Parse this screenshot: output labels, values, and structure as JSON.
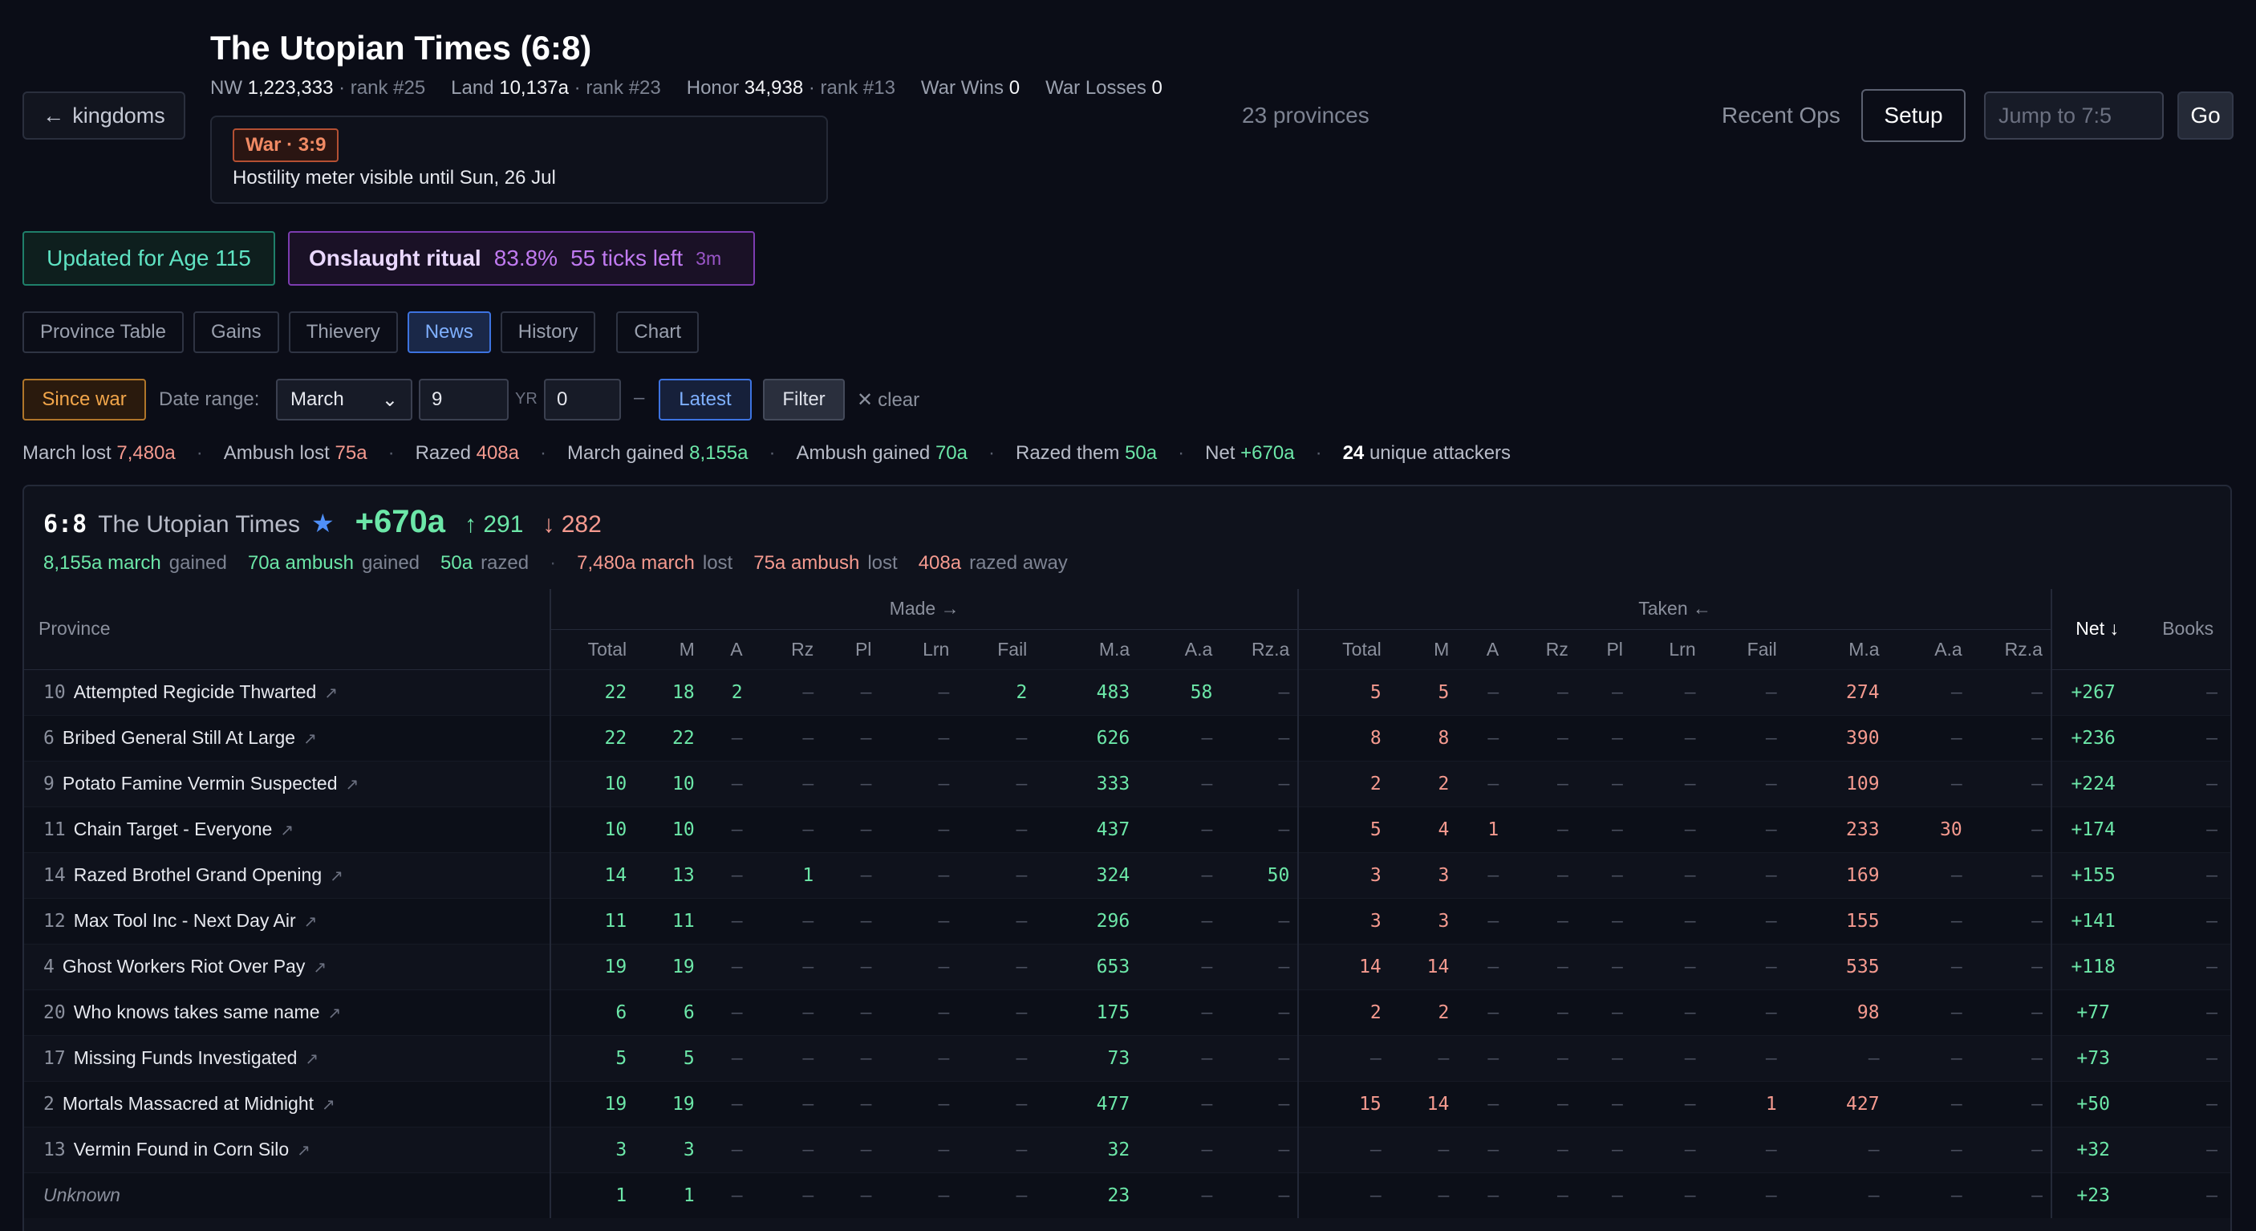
{
  "nav": {
    "back_label": "kingdoms"
  },
  "kingdom": {
    "title": "The Utopian Times (6:8)",
    "nw_label": "NW",
    "nw": "1,223,333",
    "nw_rank": "· rank #25",
    "land_label": "Land",
    "land": "10,137a",
    "land_rank": "· rank #23",
    "honor_label": "Honor",
    "honor": "34,938",
    "honor_rank": "· rank #13",
    "war_wins_label": "War Wins",
    "war_wins": "0",
    "war_losses_label": "War Losses",
    "war_losses": "0",
    "war_badge": "War · 3:9",
    "war_text": "Hostility meter visible until Sun, 26 Jul",
    "province_count": "23 provinces"
  },
  "toolbar": {
    "recent_ops": "Recent Ops",
    "setup": "Setup",
    "jump_placeholder": "Jump to 7:5",
    "go": "Go"
  },
  "pills": {
    "age": "Updated for Age 115",
    "ritual_name": "Onslaught ritual",
    "ritual_pct": "83.8%",
    "ritual_ticks": "55 ticks left",
    "ritual_age": "3m"
  },
  "tabs": [
    {
      "label": "Province Table"
    },
    {
      "label": "Gains"
    },
    {
      "label": "Thievery"
    },
    {
      "label": "News"
    },
    {
      "label": "History"
    },
    {
      "label": "Chart"
    }
  ],
  "filters": {
    "since_war": "Since war",
    "date_range_label": "Date range:",
    "month": "March",
    "day": "9",
    "yr_label": "YR",
    "yr": "0",
    "dash": "–",
    "latest": "Latest",
    "filter": "Filter",
    "clear": "clear"
  },
  "summary": {
    "march_lost_label": "March lost",
    "march_lost": "7,480a",
    "ambush_lost_label": "Ambush lost",
    "ambush_lost": "75a",
    "razed_label": "Razed",
    "razed": "408a",
    "march_gained_label": "March gained",
    "march_gained": "8,155a",
    "ambush_gained_label": "Ambush gained",
    "ambush_gained": "70a",
    "razed_them_label": "Razed them",
    "razed_them": "50a",
    "net_label": "Net",
    "net": "+670a",
    "unique_count": "24",
    "unique_label": "unique attackers"
  },
  "panel": {
    "loc": "6:8",
    "name": "The Utopian Times",
    "net": "+670a",
    "up": "291",
    "down": "282",
    "gained_march": "8,155a march",
    "gained_march_suffix": "gained",
    "gained_ambush": "70a ambush",
    "gained_ambush_suffix": "gained",
    "gained_razed": "50a",
    "gained_razed_suffix": "razed",
    "lost_march": "7,480a march",
    "lost_march_suffix": "lost",
    "lost_ambush": "75a ambush",
    "lost_ambush_suffix": "lost",
    "lost_razed": "408a",
    "lost_razed_suffix": "razed away"
  },
  "table": {
    "group_made": "Made →",
    "group_taken": "Taken ←",
    "col_province": "Province",
    "col_net": "Net ↓",
    "col_books": "Books",
    "sub_cols": [
      "Total",
      "M",
      "A",
      "Rz",
      "Pl",
      "Lrn",
      "Fail",
      "M.a",
      "A.a",
      "Rz.a"
    ],
    "rows": [
      {
        "idx": "10",
        "name": "Attempted Regicide Thwarted",
        "made": [
          "22",
          "18",
          "2",
          "–",
          "–",
          "–",
          "2",
          "483",
          "58",
          "–"
        ],
        "taken": [
          "5",
          "5",
          "–",
          "–",
          "–",
          "–",
          "–",
          "274",
          "–",
          "–"
        ],
        "net": "+267",
        "books": "–"
      },
      {
        "idx": "6",
        "name": "Bribed General Still At Large",
        "made": [
          "22",
          "22",
          "–",
          "–",
          "–",
          "–",
          "–",
          "626",
          "–",
          "–"
        ],
        "taken": [
          "8",
          "8",
          "–",
          "–",
          "–",
          "–",
          "–",
          "390",
          "–",
          "–"
        ],
        "net": "+236",
        "books": "–"
      },
      {
        "idx": "9",
        "name": "Potato Famine Vermin Suspected",
        "made": [
          "10",
          "10",
          "–",
          "–",
          "–",
          "–",
          "–",
          "333",
          "–",
          "–"
        ],
        "taken": [
          "2",
          "2",
          "–",
          "–",
          "–",
          "–",
          "–",
          "109",
          "–",
          "–"
        ],
        "net": "+224",
        "books": "–"
      },
      {
        "idx": "11",
        "name": "Chain Target - Everyone",
        "made": [
          "10",
          "10",
          "–",
          "–",
          "–",
          "–",
          "–",
          "437",
          "–",
          "–"
        ],
        "taken": [
          "5",
          "4",
          "1",
          "–",
          "–",
          "–",
          "–",
          "233",
          "30",
          "–"
        ],
        "net": "+174",
        "books": "–"
      },
      {
        "idx": "14",
        "name": "Razed Brothel Grand Opening",
        "made": [
          "14",
          "13",
          "–",
          "1",
          "–",
          "–",
          "–",
          "324",
          "–",
          "50"
        ],
        "taken": [
          "3",
          "3",
          "–",
          "–",
          "–",
          "–",
          "–",
          "169",
          "–",
          "–"
        ],
        "net": "+155",
        "books": "–"
      },
      {
        "idx": "12",
        "name": "Max Tool Inc - Next Day Air",
        "made": [
          "11",
          "11",
          "–",
          "–",
          "–",
          "–",
          "–",
          "296",
          "–",
          "–"
        ],
        "taken": [
          "3",
          "3",
          "–",
          "–",
          "–",
          "–",
          "–",
          "155",
          "–",
          "–"
        ],
        "net": "+141",
        "books": "–"
      },
      {
        "idx": "4",
        "name": "Ghost Workers Riot Over Pay",
        "made": [
          "19",
          "19",
          "–",
          "–",
          "–",
          "–",
          "–",
          "653",
          "–",
          "–"
        ],
        "taken": [
          "14",
          "14",
          "–",
          "–",
          "–",
          "–",
          "–",
          "535",
          "–",
          "–"
        ],
        "net": "+118",
        "books": "–"
      },
      {
        "idx": "20",
        "name": "Who knows takes same name",
        "made": [
          "6",
          "6",
          "–",
          "–",
          "–",
          "–",
          "–",
          "175",
          "–",
          "–"
        ],
        "taken": [
          "2",
          "2",
          "–",
          "–",
          "–",
          "–",
          "–",
          "98",
          "–",
          "–"
        ],
        "net": "+77",
        "books": "–"
      },
      {
        "idx": "17",
        "name": "Missing Funds Investigated",
        "made": [
          "5",
          "5",
          "–",
          "–",
          "–",
          "–",
          "–",
          "73",
          "–",
          "–"
        ],
        "taken": [
          "–",
          "–",
          "–",
          "–",
          "–",
          "–",
          "–",
          "–",
          "–",
          "–"
        ],
        "net": "+73",
        "books": "–"
      },
      {
        "idx": "2",
        "name": "Mortals Massacred at Midnight",
        "made": [
          "19",
          "19",
          "–",
          "–",
          "–",
          "–",
          "–",
          "477",
          "–",
          "–"
        ],
        "taken": [
          "15",
          "14",
          "–",
          "–",
          "–",
          "–",
          "1",
          "427",
          "–",
          "–"
        ],
        "net": "+50",
        "books": "–"
      },
      {
        "idx": "13",
        "name": "Vermin Found in Corn Silo",
        "made": [
          "3",
          "3",
          "–",
          "–",
          "–",
          "–",
          "–",
          "32",
          "–",
          "–"
        ],
        "taken": [
          "–",
          "–",
          "–",
          "–",
          "–",
          "–",
          "–",
          "–",
          "–",
          "–"
        ],
        "net": "+32",
        "books": "–"
      },
      {
        "idx": "",
        "name": "Unknown",
        "made": [
          "1",
          "1",
          "–",
          "–",
          "–",
          "–",
          "–",
          "23",
          "–",
          "–"
        ],
        "taken": [
          "–",
          "–",
          "–",
          "–",
          "–",
          "–",
          "–",
          "–",
          "–",
          "–"
        ],
        "net": "+23",
        "books": "–"
      }
    ]
  }
}
